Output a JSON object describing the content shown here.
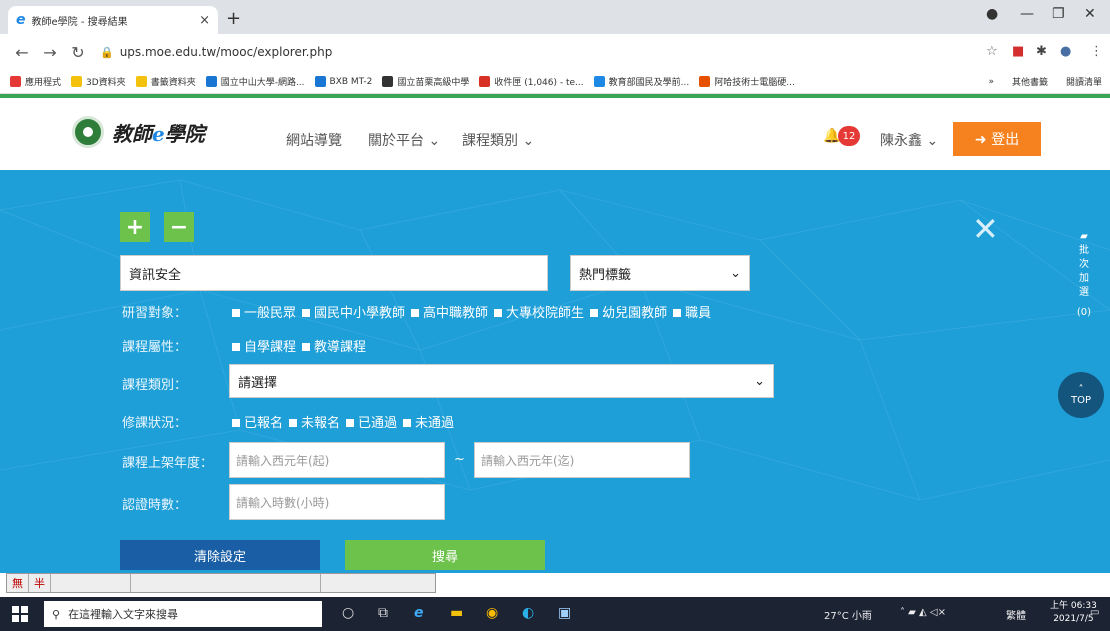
{
  "browser": {
    "tab_title": "教師e學院 - 搜尋結果",
    "tab_close": "×",
    "new_tab": "+",
    "url": "ups.moe.edu.tw/mooc/explorer.php",
    "window_controls": [
      "—",
      "❐",
      "✕"
    ]
  },
  "bookmarks": [
    {
      "label": "應用程式",
      "color": "#e53935"
    },
    {
      "label": "3D資料夾",
      "color": "#f4c20d"
    },
    {
      "label": "書籤資料夾",
      "color": "#f4c20d"
    },
    {
      "label": "國立中山大學-網路...",
      "color": "#1976d2"
    },
    {
      "label": "BXB MT-2",
      "color": "#1976d2"
    },
    {
      "label": "國立苗栗高級中學",
      "color": "#333333"
    },
    {
      "label": "收件匣 (1,046) - te...",
      "color": "#d93025"
    },
    {
      "label": "教育部國民及學前...",
      "color": "#1e88e5"
    },
    {
      "label": "阿哈技術士電腦硬...",
      "color": "#e65100"
    }
  ],
  "bookmarks_right": [
    {
      "label": "»"
    },
    {
      "label": "其他書籤"
    },
    {
      "label": "閱讀清單"
    }
  ],
  "site": {
    "logo_text_a": "教師",
    "logo_text_e": "e",
    "logo_text_b": "學院",
    "menu": [
      "網站導覽",
      "關於平台 ⌄",
      "課程類別 ⌄"
    ],
    "notification_count": "12",
    "user_name": "陳永鑫 ⌄",
    "logout_label": "➜ 登出"
  },
  "search": {
    "add_label": "+",
    "remove_label": "−",
    "close_label": "✕",
    "keyword_value": "資訊安全",
    "hot_tags_label": "熱門標籤",
    "target_label": "研習對象：",
    "target_options": [
      "一般民眾",
      "國民中小學教師",
      "高中職教師",
      "大專校院師生",
      "幼兒園教師",
      "職員"
    ],
    "attr_label": "課程屬性：",
    "attr_options": [
      "自學課程",
      "教導課程"
    ],
    "category_label": "課程類別：",
    "category_value": "請選擇",
    "status_label": "修課狀況：",
    "status_options": [
      "已報名",
      "未報名",
      "已通過",
      "未通過"
    ],
    "year_label": "課程上架年度：",
    "year_from_placeholder": "請輸入西元年(起)",
    "year_separator": "~",
    "year_to_placeholder": "請輸入西元年(迄)",
    "hours_label": "認證時數：",
    "hours_placeholder": "請輸入時數(小時)",
    "clear_button": "清除設定",
    "search_button": "搜尋"
  },
  "side_panel": {
    "text": "批次加選",
    "count": "(0)",
    "top_label": "TOP"
  },
  "ime": {
    "mode_a": "無",
    "mode_b": "半"
  },
  "taskbar": {
    "search_placeholder": "在這裡輸入文字來搜尋",
    "weather": "27°C 小雨",
    "ime_lang": "繁體",
    "time": "上午 06:33",
    "date": "2021/7/5"
  }
}
